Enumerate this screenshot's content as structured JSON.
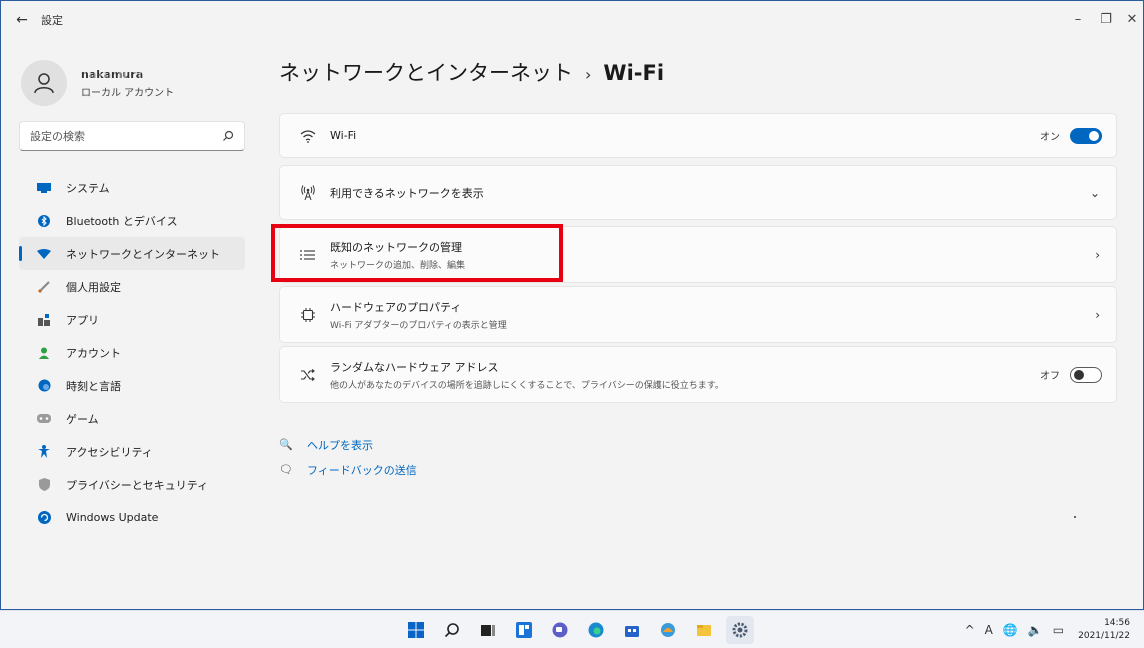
{
  "window": {
    "app_title": "設定",
    "back": "←",
    "minimize": "–",
    "restore": "❐",
    "close": "✕"
  },
  "user": {
    "name": "nakamura",
    "account_type": "ローカル アカウント"
  },
  "search": {
    "placeholder": "設定の検索"
  },
  "nav": {
    "items": [
      {
        "label": "システム",
        "icon": "monitor-icon",
        "color": "#0067c0"
      },
      {
        "label": "Bluetooth とデバイス",
        "icon": "bluetooth-icon",
        "color": "#0067c0"
      },
      {
        "label": "ネットワークとインターネット",
        "icon": "wifi-icon",
        "color": "#0067c0",
        "active": true
      },
      {
        "label": "個人用設定",
        "icon": "brush-icon",
        "color": "#c46a2b"
      },
      {
        "label": "アプリ",
        "icon": "apps-icon",
        "color": "#555555"
      },
      {
        "label": "アカウント",
        "icon": "person-icon",
        "color": "#2ea043"
      },
      {
        "label": "時刻と言語",
        "icon": "globe-clock-icon",
        "color": "#0067c0"
      },
      {
        "label": "ゲーム",
        "icon": "gamepad-icon",
        "color": "#888888"
      },
      {
        "label": "アクセシビリティ",
        "icon": "accessibility-icon",
        "color": "#0067c0"
      },
      {
        "label": "プライバシーとセキュリティ",
        "icon": "shield-icon",
        "color": "#888888"
      },
      {
        "label": "Windows Update",
        "icon": "update-icon",
        "color": "#0067c0"
      }
    ]
  },
  "header": {
    "breadcrumb_parent": "ネットワークとインターネット",
    "separator": "›",
    "breadcrumb_current": "Wi-Fi"
  },
  "cards": {
    "wifi": {
      "title": "Wi-Fi",
      "toggle_label": "オン",
      "state": "on"
    },
    "available": {
      "title": "利用できるネットワークを表示",
      "chevron": "⌄"
    },
    "known": {
      "title": "既知のネットワークの管理",
      "subtitle": "ネットワークの追加、削除、編集",
      "chevron": "›"
    },
    "hardware": {
      "title": "ハードウェアのプロパティ",
      "subtitle": "Wi-Fi アダプターのプロパティの表示と管理",
      "chevron": "›"
    },
    "random": {
      "title": "ランダムなハードウェア アドレス",
      "subtitle": "他の人があなたのデバイスの場所を追跡しにくくすることで、プライバシーの保護に役立ちます。",
      "toggle_label": "オフ",
      "state": "off"
    }
  },
  "links": {
    "help": "ヘルプを表示",
    "feedback": "フィードバックの送信"
  },
  "taskbar": {
    "apps": [
      "windows-start-icon",
      "search-icon",
      "task-view-icon",
      "widgets-icon",
      "chat-icon",
      "edge-icon",
      "store-icon",
      "app-icon",
      "explorer-icon",
      "settings-icon"
    ],
    "tray_chevron": "^",
    "ime": "A",
    "time": "14:56",
    "date": "2021/11/22"
  },
  "colors": {
    "accent": "#0067c0",
    "highlight_box": "#e60012"
  }
}
